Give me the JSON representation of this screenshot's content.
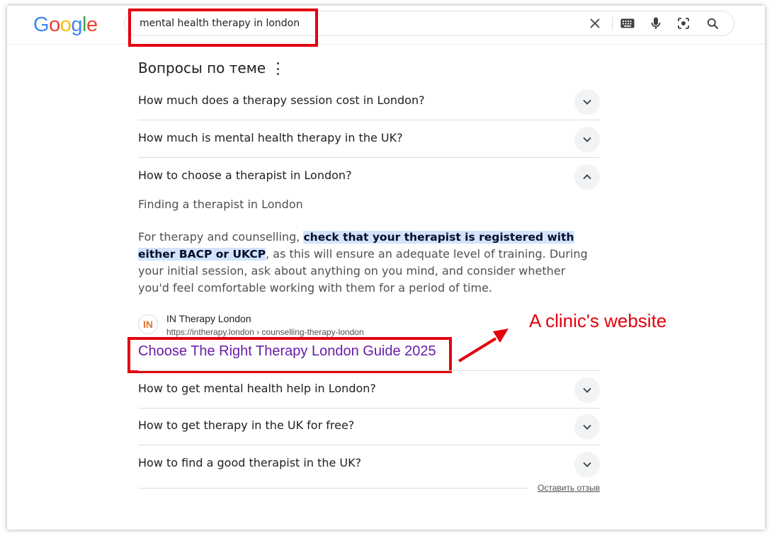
{
  "brand": {
    "logo_letters": [
      "G",
      "o",
      "o",
      "g",
      "l",
      "e"
    ],
    "logo_colors": [
      "#4285F4",
      "#EA4335",
      "#FBBC05",
      "#4285F4",
      "#34A853",
      "#EA4335"
    ]
  },
  "search": {
    "query": "mental health therapy in london",
    "icons": [
      "close-icon",
      "keyboard-icon",
      "microphone-icon",
      "lens-icon",
      "search-icon"
    ]
  },
  "paa": {
    "title": "Вопросы по теме",
    "questions": [
      {
        "text": "How much does a therapy session cost in London?",
        "expanded": false
      },
      {
        "text": "How much is mental health therapy in the UK?",
        "expanded": false
      },
      {
        "text": "How to choose a therapist in London?",
        "expanded": true
      },
      {
        "text": "How to get mental health help in London?",
        "expanded": false
      },
      {
        "text": "How to get therapy in the UK for free?",
        "expanded": false
      },
      {
        "text": "How to find a good therapist in the UK?",
        "expanded": false
      }
    ],
    "answer": {
      "heading": "Finding a therapist in London",
      "text_before": "For therapy and counselling, ",
      "highlight": "check that your therapist is registered with either BACP or UKCP",
      "text_after": ", as this will ensure an adequate level of training. During your initial session, ask about anything on you mind, and consider whether you'd feel comfortable working with them for a period of time."
    },
    "source": {
      "favicon_text": "IN",
      "name": "IN Therapy London",
      "url": "https://intherapy.london › counselling-therapy-london",
      "link_title": "Choose The Right Therapy London Guide 2025"
    },
    "feedback": "Оставить отзыв"
  },
  "annotation": {
    "label": "A clinic's website",
    "color": "#e3000f"
  },
  "colors": {
    "link_visited": "#681da8",
    "highlight_bg": "#d3e3fd"
  }
}
